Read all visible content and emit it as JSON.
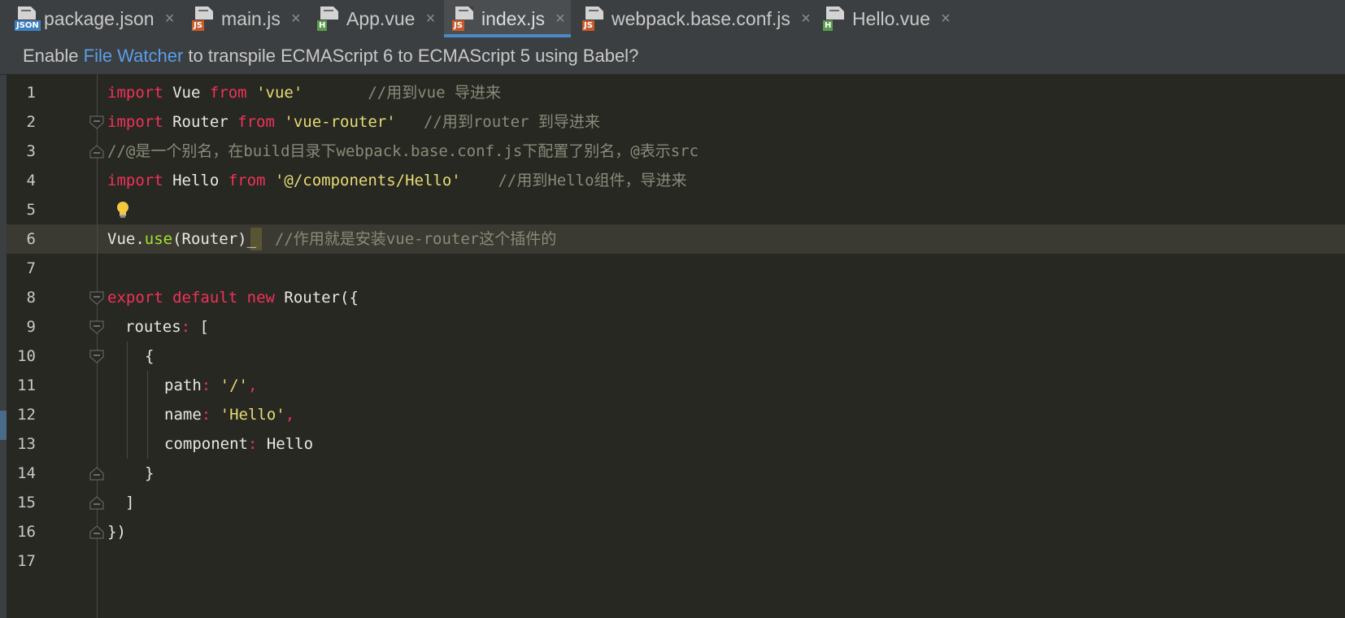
{
  "tabs": [
    {
      "label": "package.json",
      "badge": "JSON",
      "type": "json"
    },
    {
      "label": "main.js",
      "badge": "JS",
      "type": "js"
    },
    {
      "label": "App.vue",
      "badge": "H",
      "type": "vue"
    },
    {
      "label": "index.js",
      "badge": "JS",
      "type": "js",
      "active": true
    },
    {
      "label": "webpack.base.conf.js",
      "badge": "JS",
      "type": "js"
    },
    {
      "label": "Hello.vue",
      "badge": "H",
      "type": "vue"
    }
  ],
  "tab_close_glyph": "×",
  "banner": {
    "prefix": "Enable ",
    "link": "File Watcher",
    "suffix": " to transpile ECMAScript 6 to ECMAScript 5 using Babel?"
  },
  "editor": {
    "current_line": 6,
    "lines": [
      {
        "n": "1"
      },
      {
        "n": "2"
      },
      {
        "n": "3"
      },
      {
        "n": "4"
      },
      {
        "n": "5"
      },
      {
        "n": "6"
      },
      {
        "n": "7"
      },
      {
        "n": "8"
      },
      {
        "n": "9"
      },
      {
        "n": "10"
      },
      {
        "n": "11"
      },
      {
        "n": "12"
      },
      {
        "n": "13"
      },
      {
        "n": "14"
      },
      {
        "n": "15"
      },
      {
        "n": "16"
      },
      {
        "n": "17"
      }
    ],
    "code": {
      "l1": {
        "kw1": "import",
        "id": " Vue ",
        "kw2": "from",
        "sp": " ",
        "str": "'vue'",
        "cmt": "       //用到vue 导进来"
      },
      "l2": {
        "kw1": "import",
        "id": " Router ",
        "kw2": "from",
        "sp": " ",
        "str": "'vue-router'",
        "cmt": "   //用到router 到导进来"
      },
      "l3": {
        "cmt": "//@是一个别名，在build目录下webpack.base.conf.js下配置了别名，@表示src"
      },
      "l4": {
        "kw1": "import",
        "id": " Hello ",
        "kw2": "from",
        "sp": " ",
        "str": "'@/components/Hello'",
        "cmt": "    //用到Hello组件，导进来"
      },
      "l6": {
        "obj": "Vue",
        "dot": ".",
        "fn": "use",
        "args": "(Router)",
        "cursor": "_",
        "cmt": "  //作用就是安装vue-router这个插件的"
      },
      "l8": {
        "kw1": "export",
        "kw2": "default",
        "kw3": "new",
        "rest": " Router({"
      },
      "l9": {
        "key": "routes",
        "colon": ":",
        "rest": " ["
      },
      "l10": {
        "rest": "{"
      },
      "l11": {
        "key": "path",
        "colon": ":",
        "sp": " ",
        "str": "'/'",
        "rest": ","
      },
      "l12": {
        "key": "name",
        "colon": ":",
        "sp": " ",
        "str": "'Hello'",
        "rest": ","
      },
      "l13": {
        "key": "component",
        "colon": ":",
        "rest": " Hello"
      },
      "l14": {
        "rest": "}"
      },
      "l15": {
        "rest": "]"
      },
      "l16": {
        "rest": "})"
      }
    }
  },
  "colors": {
    "keyword": "#f0325a",
    "string": "#e6db74",
    "comment": "#8a8a7a",
    "function": "#a6e22e",
    "link": "#5a9ee8",
    "background": "#272822"
  },
  "icons": {
    "intention": "lightbulb-icon",
    "fold": "fold-marker-icon",
    "file": "file-type-icon"
  }
}
